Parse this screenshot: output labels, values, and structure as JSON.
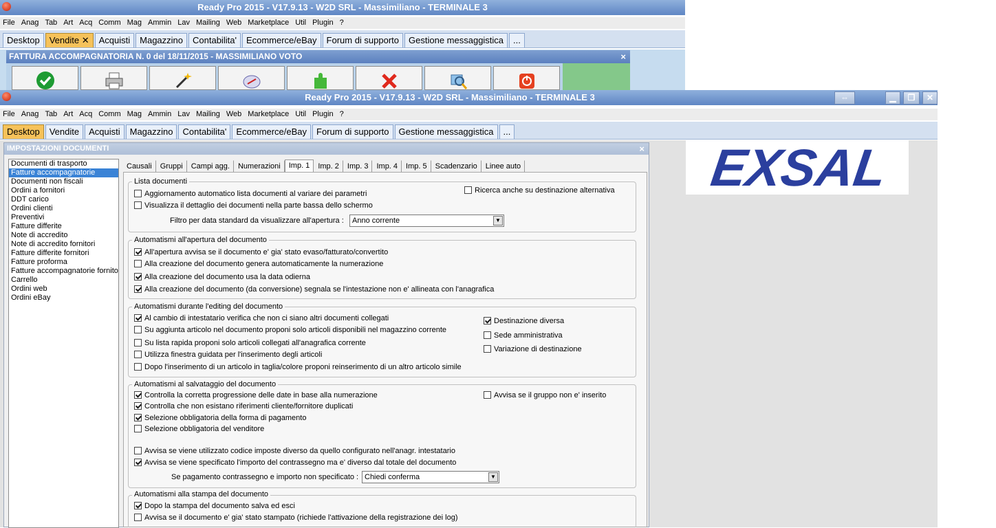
{
  "back_window": {
    "title": "Ready Pro 2015 - V17.9.13 - W2D SRL - Massimiliano - TERMINALE 3",
    "menu": [
      "File",
      "Anag",
      "Tab",
      "Art",
      "Acq",
      "Comm",
      "Mag",
      "Ammin",
      "Lav",
      "Mailing",
      "Web",
      "Marketplace",
      "Util",
      "Plugin",
      "?"
    ],
    "tabs": [
      "Desktop",
      "Vendite",
      "Acquisti",
      "Magazzino",
      "Contabilita'",
      "Ecommerce/eBay",
      "Forum di supporto",
      "Gestione messaggistica",
      "..."
    ],
    "active_tab_close": "✕",
    "document_title": "FATTURA ACCOMPAGNATORIA N. 0 del 18/11/2015 - MASSIMILIANO VOTO",
    "close_glyph": "×"
  },
  "front_window": {
    "title": "Ready Pro 2015 - V17.9.13 - W2D SRL - Massimiliano - TERMINALE 3",
    "menu": [
      "File",
      "Anag",
      "Tab",
      "Art",
      "Acq",
      "Comm",
      "Mag",
      "Ammin",
      "Lav",
      "Mailing",
      "Web",
      "Marketplace",
      "Util",
      "Plugin",
      "?"
    ],
    "tabs": [
      "Desktop",
      "Vendite",
      "Acquisti",
      "Magazzino",
      "Contabilita'",
      "Ecommerce/eBay",
      "Forum di supporto",
      "Gestione messaggistica",
      "..."
    ],
    "window_buttons": [
      "⇔",
      "▁",
      "❐",
      "✕"
    ]
  },
  "dialog": {
    "title": "IMPOSTAZIONI DOCUMENTI",
    "close_glyph": "×",
    "doc_types": [
      "Documenti di trasporto",
      "Fatture accompagnatorie",
      "Documenti non fiscali",
      "Ordini a fornitori",
      "DDT carico",
      "Ordini clienti",
      "Preventivi",
      "Fatture differite",
      "Note di accredito",
      "Note di accredito fornitori",
      "Fatture differite fornitori",
      "Fatture proforma",
      "Fatture accompagnatorie fornito",
      "Carrello",
      "Ordini web",
      "Ordini eBay"
    ],
    "subtabs": [
      "Causali",
      "Gruppi",
      "Campi agg.",
      "Numerazioni",
      "Imp. 1",
      "Imp. 2",
      "Imp. 3",
      "Imp. 4",
      "Imp. 5",
      "Scadenzario",
      "Linee auto"
    ],
    "g1": {
      "title": "Lista documenti",
      "c1": "Aggiornamento automatico lista documenti al variare dei parametri",
      "c2": "Visualizza il dettaglio dei documenti nella parte bassa dello schermo",
      "c3": "Ricerca anche su destinazione alternativa",
      "filter_label": "Filtro per data standard da visualizzare all'apertura :",
      "filter_value": "Anno corrente"
    },
    "g2": {
      "title": "Automatismi all'apertura del documento",
      "c1": "All'apertura avvisa se il documento e' gia' stato evaso/fatturato/convertito",
      "c2": "Alla creazione del documento genera automaticamente la numerazione",
      "c3": "Alla creazione del documento usa la data odierna",
      "c4": "Alla creazione del documento (da conversione) segnala se l'intestazione non e' allineata con l'anagrafica"
    },
    "g3": {
      "title": "Automatismi durante l'editing del documento",
      "c1": "Al cambio di intestatario verifica che non ci siano altri documenti collegati",
      "c2": "Su aggiunta articolo nel documento proponi solo articoli disponibili nel magazzino corrente",
      "c3": "Su lista rapida proponi solo articoli collegati all'anagrafica corrente",
      "c4": "Utilizza finestra guidata per l'inserimento degli articoli",
      "c5": "Dopo l'inserimento di un articolo in taglia/colore proponi reinserimento di un altro articolo simile",
      "r1": "Destinazione diversa",
      "r2": "Sede amministrativa",
      "r3": "Variazione di destinazione"
    },
    "g4": {
      "title": "Automatismi al salvataggio del documento",
      "c1": "Controlla la corretta progressione delle date in base alla numerazione",
      "c2": "Controlla che non esistano riferimenti cliente/fornitore duplicati",
      "c3": "Selezione obbligatoria della forma di pagamento",
      "c4": "Selezione obbligatoria del venditore",
      "c5": "Avvisa se viene utilizzato codice imposte diverso da quello configurato nell'anagr. intestatario",
      "c6": "Avvisa se viene specificato l'importo del contrassegno ma e' diverso dal totale del documento",
      "r1": "Avvisa se il gruppo non e' inserito",
      "cod_label": "Se pagamento contrassegno e importo non specificato :",
      "cod_value": "Chiedi conferma"
    },
    "g5": {
      "title": "Automatismi alla stampa del documento",
      "c1": "Dopo la stampa del documento salva ed esci",
      "c2": "Avvisa se il documento e' gia' stato stampato (richiede l'attivazione della registrazione dei log)"
    }
  },
  "logo": {
    "text": "EXSAL",
    "color": "#2b3f9e"
  },
  "colors": {
    "active_tab": "#f6c25a",
    "selection": "#3a83d6",
    "titlebar": "#6a8fca"
  }
}
